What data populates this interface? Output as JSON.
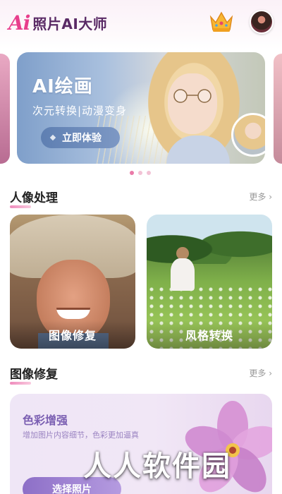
{
  "header": {
    "logo_ai": "Ai",
    "logo_text": "照片AI大师",
    "crown_icon": "crown-icon",
    "avatar_icon": "user-avatar"
  },
  "banner": {
    "title": "AI绘画",
    "subtitle": "次元转换|动漫变身",
    "button_label": "立即体验",
    "pager_count": 3,
    "pager_active": 0
  },
  "section_portrait": {
    "title": "人像处理",
    "more": "更多 ›",
    "cards": [
      {
        "label": "图像修复"
      },
      {
        "label": "风格转换"
      }
    ]
  },
  "section_repair": {
    "title": "图像修复",
    "more": "更多 ›",
    "card": {
      "title": "色彩增强",
      "description": "增加图片内容细节，色彩更加逼真",
      "button_label": "选择照片"
    }
  },
  "watermark": "人人软件园",
  "colors": {
    "brand_pink": "#e83e8c",
    "brand_purple": "#5a2a66",
    "accent_violet": "#8d6fc7"
  }
}
